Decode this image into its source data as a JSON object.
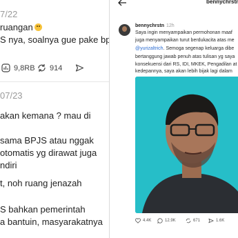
{
  "left": {
    "post1": {
      "time": "7/22",
      "lines": [
        "ruangan",
        "S nya, soalnya gue pake bpjs"
      ],
      "actions": {
        "views": "9,8RB",
        "reposts": "914"
      }
    },
    "post2": {
      "time": "07/23",
      "lines": [
        "akan kemana ? mau di",
        "sama BPJS atau nggak",
        "otomatis yg dirawat juga",
        "ndiri",
        "t, noh ruang jenazah",
        "S bahkan pemerintah",
        "a bantuin, masyarakatnya"
      ]
    }
  },
  "right": {
    "top_username": "bennychrstn",
    "post": {
      "author": "bennychrstn",
      "time": "12h",
      "caption": [
        "Saya ingin menyampaikan permohonan maaf",
        "juga menyampaikan turut berdukacita atas me",
        "@yurizaltrich. Semoga segenap keluarga dibe",
        "bertanggung jawab penuh atas tulisan yg saya",
        "konsekuensi dari RS, IDI, MKEK, Pengadilan at",
        "kedepannya, saya akan lebih bijak lagi dalam"
      ],
      "mention": "@yurizaltrich",
      "actions": {
        "likes": "4.4K",
        "comments": "12.9K",
        "reposts": "671",
        "shares": "1.6K"
      }
    }
  },
  "colors": {
    "link": "#2a6bd1",
    "video_bg": "#27bfc9",
    "emoji": "#f7c33b"
  }
}
